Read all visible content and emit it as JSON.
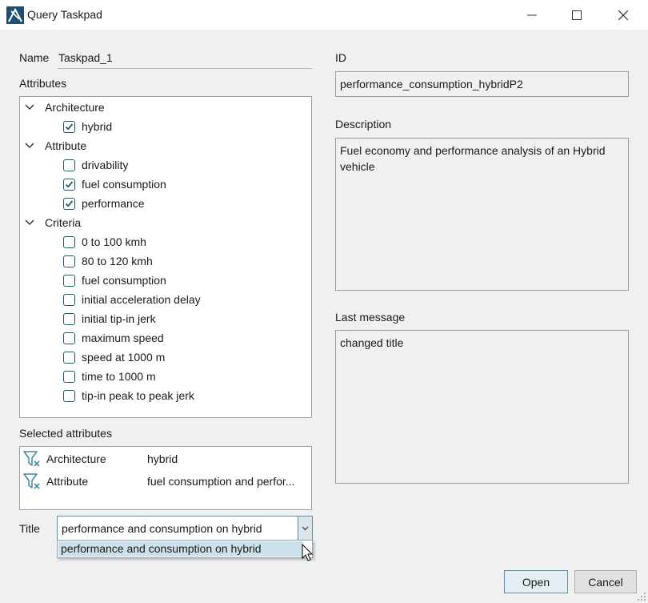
{
  "window": {
    "title": "Query Taskpad",
    "icons": [
      "app-icon",
      "minimize-icon",
      "maximize-icon",
      "close-icon"
    ]
  },
  "name": {
    "label": "Name",
    "value": "Taskpad_1"
  },
  "attributes": {
    "label": "Attributes",
    "groups": [
      {
        "name": "Architecture",
        "expanded": true,
        "items": [
          {
            "label": "hybrid",
            "checked": true
          }
        ]
      },
      {
        "name": "Attribute",
        "expanded": true,
        "items": [
          {
            "label": "drivability",
            "checked": false
          },
          {
            "label": "fuel consumption",
            "checked": true
          },
          {
            "label": "performance",
            "checked": true
          }
        ]
      },
      {
        "name": "Criteria",
        "expanded": true,
        "items": [
          {
            "label": "0 to 100 kmh",
            "checked": false
          },
          {
            "label": "80 to 120 kmh",
            "checked": false
          },
          {
            "label": "fuel consumption",
            "checked": false
          },
          {
            "label": "initial acceleration delay",
            "checked": false
          },
          {
            "label": "initial tip-in jerk",
            "checked": false
          },
          {
            "label": "maximum speed",
            "checked": false
          },
          {
            "label": "speed at 1000 m",
            "checked": false
          },
          {
            "label": "time to 1000 m",
            "checked": false
          },
          {
            "label": "tip-in peak to peak jerk",
            "checked": false
          }
        ]
      }
    ]
  },
  "selected_attributes": {
    "label": "Selected attributes",
    "rows": [
      {
        "key": "Architecture",
        "value": "hybrid",
        "icon": "filter-remove-icon"
      },
      {
        "key": "Attribute",
        "value": "fuel consumption and perfor...",
        "icon": "filter-remove-icon"
      }
    ]
  },
  "title_field": {
    "label": "Title",
    "value": "performance and consumption on hybrid",
    "dropdown_option": "performance and consumption on hybrid"
  },
  "id_field": {
    "label": "ID",
    "value": "performance_consumption_hybridP2"
  },
  "description": {
    "label": "Description",
    "value": "Fuel economy and performance analysis of an Hybrid vehicle"
  },
  "last_message": {
    "label": "Last message",
    "value": "changed title"
  },
  "buttons": {
    "open": "Open",
    "cancel": "Cancel"
  },
  "colors": {
    "checkbox": "#1d5a73",
    "accent": "#5a8fa8",
    "filter_icon": "#3f8aa6"
  }
}
